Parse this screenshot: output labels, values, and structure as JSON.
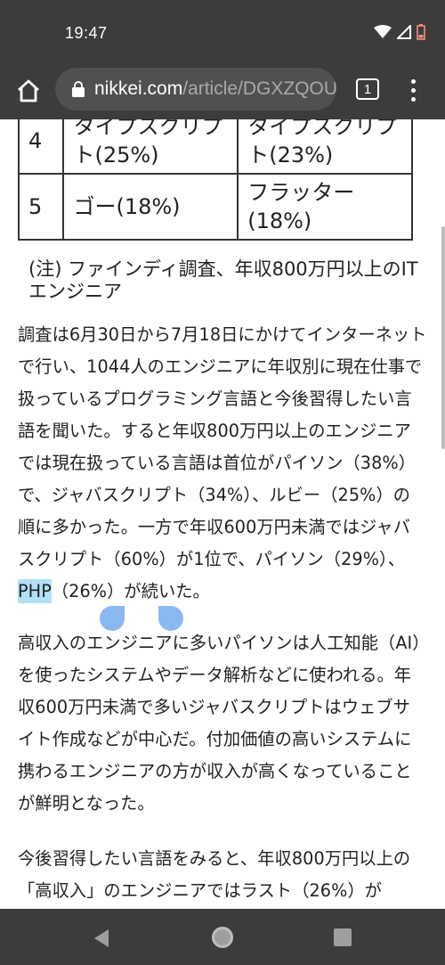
{
  "status": {
    "time": "19:47"
  },
  "toolbar": {
    "url_domain": "nikkei.com",
    "url_path": "/article/DGXZQOU",
    "tab_count": "1"
  },
  "table": {
    "rows": [
      {
        "rank": "4",
        "col1": "タイプスクリプト(25%)",
        "col2": "タイプスクリプト(23%)"
      },
      {
        "rank": "5",
        "col1": "ゴー(18%)",
        "col2": "フラッター(18%)"
      }
    ]
  },
  "note": "(注) ファインディ調査、年収800万円以上のITエンジニア",
  "paragraphs": {
    "p1_before": "調査は6月30日から7月18日にかけてインターネットで行い、1044人のエンジニアに年収別に現在仕事で扱っているプログラミング言語と今後習得したい言語を聞いた。すると年収800万円以上のエンジニアでは現在扱っている言語は首位がパイソン（38%）で、ジャバスクリプト（34%）、ルビー（25%）の順に多かった。一方で年収600万円未満ではジャバスクリプト（60%）が1位で、パイソン（29%）、",
    "p1_highlight": "PHP",
    "p1_after": "（26%）が続いた。",
    "p2": "高収入のエンジニアに多いパイソンは人工知能（AI）を使ったシステムやデータ解析などに使われる。年収600万円未満で多いジャバスクリプトはウェブサイト作成などが中心だ。付加価値の高いシステムに携わるエンジニアの方が収入が高くなっていることが鮮明となった。",
    "p3": "今後習得したい言語をみると、年収800万円以上の「高収入」のエンジニアではラスト（26%）が"
  },
  "colors": {
    "chrome_bg": "#3c3c3c",
    "url_pill": "#505050",
    "selection": "#b3dff7",
    "selection_handle": "#8cb8f2"
  }
}
